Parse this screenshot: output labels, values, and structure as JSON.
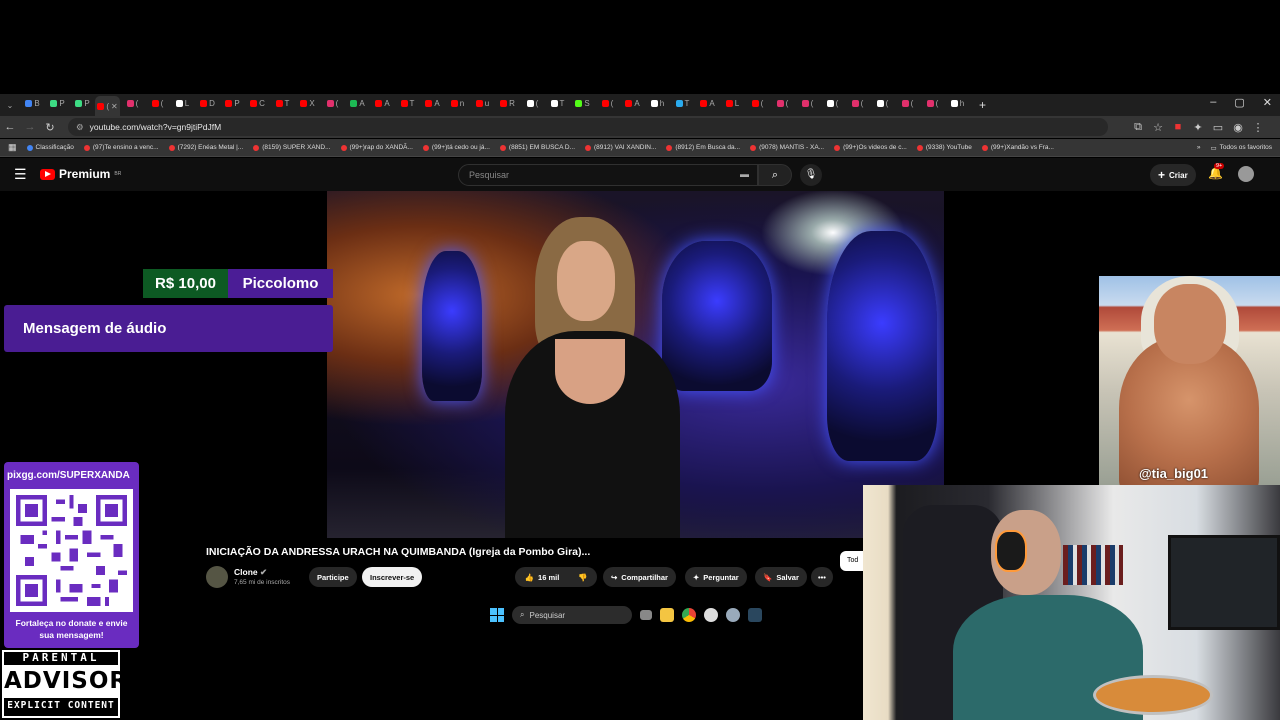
{
  "browser": {
    "tabs": [
      {
        "label": "B",
        "color": "#4285f4"
      },
      {
        "label": "P",
        "color": "#3ddc84"
      },
      {
        "label": "P",
        "color": "#3ddc84"
      },
      {
        "label": "(",
        "color": "#ff0000",
        "active": true
      },
      {
        "label": "(",
        "color": "#e1306c"
      },
      {
        "label": "(",
        "color": "#ff0000"
      },
      {
        "label": "L",
        "color": "#ffffff"
      },
      {
        "label": "D",
        "color": "#ff0000"
      },
      {
        "label": "P",
        "color": "#ff0000"
      },
      {
        "label": "C",
        "color": "#ff0000"
      },
      {
        "label": "T",
        "color": "#ff0000"
      },
      {
        "label": "X",
        "color": "#ff0000"
      },
      {
        "label": "(",
        "color": "#e1306c"
      },
      {
        "label": "A",
        "color": "#1db954"
      },
      {
        "label": "A",
        "color": "#ff0000"
      },
      {
        "label": "T",
        "color": "#ff0000"
      },
      {
        "label": "A",
        "color": "#ff0000"
      },
      {
        "label": "n",
        "color": "#ff0000"
      },
      {
        "label": "u",
        "color": "#ff0000"
      },
      {
        "label": "R",
        "color": "#ff0000"
      },
      {
        "label": "(",
        "color": "#ffffff"
      },
      {
        "label": "T",
        "color": "#ffffff"
      },
      {
        "label": "S",
        "color": "#53fc18"
      },
      {
        "label": "(",
        "color": "#ff0000"
      },
      {
        "label": "A",
        "color": "#ff0000"
      },
      {
        "label": "h",
        "color": "#ffffff"
      },
      {
        "label": "T",
        "color": "#2aabee"
      },
      {
        "label": "A",
        "color": "#ff0000"
      },
      {
        "label": "L",
        "color": "#ff0000"
      },
      {
        "label": "(",
        "color": "#ff0000"
      },
      {
        "label": "(",
        "color": "#e1306c"
      },
      {
        "label": "(",
        "color": "#e1306c"
      },
      {
        "label": "(",
        "color": "#ffffff"
      },
      {
        "label": "(",
        "color": "#e1306c"
      },
      {
        "label": "(",
        "color": "#ffffff"
      },
      {
        "label": "(",
        "color": "#e1306c"
      },
      {
        "label": "(",
        "color": "#e1306c"
      },
      {
        "label": "h",
        "color": "#ffffff"
      }
    ],
    "new_tab": "+",
    "window_controls": [
      "–",
      "▢",
      "✕"
    ],
    "url": "youtube.com/watch?v=gn9jtiPdJfM",
    "bookmarks": [
      "Classificação",
      "(97)Te ensino a venc...",
      "(7292) Enéas Metal |...",
      "(8159) SUPER XAND...",
      "(99+)rap do XANDÃ...",
      "(99+)tá cedo ou já...",
      "(8851) EM BUSCA D...",
      "(8912) VAI XANDIN...",
      "(8912) Em Busca da...",
      "(9078) MANTIS - XA...",
      "(99+)Os videos de c...",
      "(9338) YouTube",
      "(99+)Xandão vs Fra..."
    ],
    "bookmarks_more": "»",
    "all_bookmarks": "Todos os favoritos"
  },
  "youtube": {
    "logo_text": "Premium",
    "logo_badge": "BR",
    "search_placeholder": "Pesquisar",
    "create_label": "Criar",
    "notif_badge": "9+",
    "video_title": "INICIAÇÃO DA ANDRESSA URACH NA QUIMBANDA (Igreja da Pombo Gira)...",
    "channel_name": "Clone",
    "channel_subs": "7,65 mi de inscritos",
    "join_label": "Participe",
    "subscribe_label": "Inscrever-se",
    "likes": "16 mil",
    "share_label": "Compartilhar",
    "ask_label": "Perguntar",
    "save_label": "Salvar",
    "more_label": "•••",
    "side_chip": "Tod"
  },
  "donation": {
    "amount": "R$ 10,00",
    "donor": "Piccolomo",
    "message": "Mensagem de áudio"
  },
  "taskbar": {
    "search_label": "Pesquisar"
  },
  "qr_card": {
    "url": "pixgg.com/SUPERXANDA",
    "caption": "Fortaleça no donate e envie sua mensagem!"
  },
  "parental_advisory": {
    "top": "PARENTAL",
    "middle": "ADVISORY",
    "bottom": "EXPLICIT CONTENT"
  },
  "overlay_image": {
    "caption": "@tia_big01"
  },
  "colors": {
    "donation_green": "#0d5a23",
    "donation_purple": "#4b1d96",
    "qr_purple": "#6a2cc0",
    "youtube_red": "#ff0000"
  }
}
